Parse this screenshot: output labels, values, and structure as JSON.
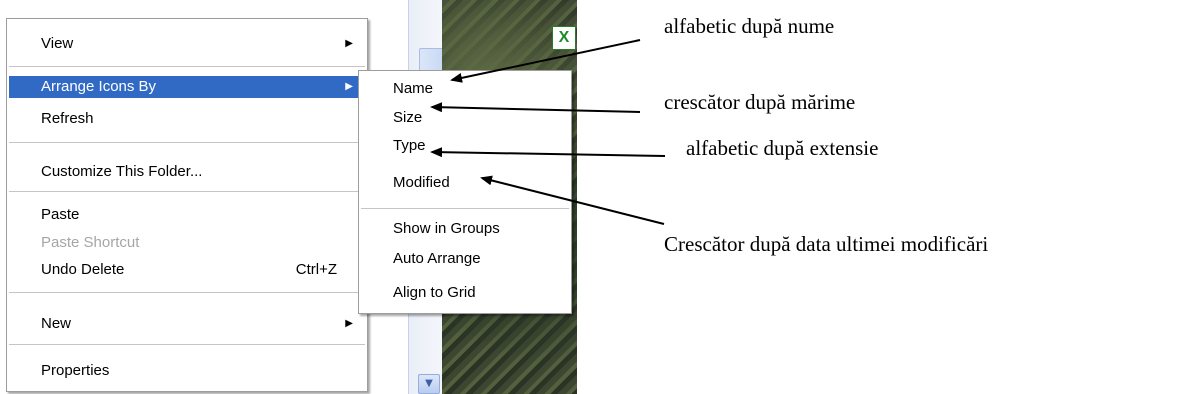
{
  "main_menu": {
    "items": [
      {
        "label": "View",
        "submenu": true
      },
      {
        "label": "Arrange Icons By",
        "submenu": true,
        "highlighted": true
      },
      {
        "label": "Refresh"
      },
      {
        "label": "Customize This Folder..."
      },
      {
        "label": "Paste"
      },
      {
        "label": "Paste Shortcut",
        "disabled": true
      },
      {
        "label": "Undo Delete",
        "shortcut": "Ctrl+Z"
      },
      {
        "label": "New",
        "submenu": true
      },
      {
        "label": "Properties"
      }
    ]
  },
  "sub_menu": {
    "items": [
      {
        "label": "Name"
      },
      {
        "label": "Size"
      },
      {
        "label": "Type"
      },
      {
        "label": "Modified"
      },
      {
        "label": "Show in Groups"
      },
      {
        "label": "Auto Arrange"
      },
      {
        "label": "Align to Grid"
      }
    ]
  },
  "annotations": {
    "name": "alfabetic după nume",
    "size": "crescător după mărime",
    "type": "alfabetic după extensie",
    "modified": "Crescător după data ultimei modificări"
  },
  "icons": {
    "submenu_arrow": "triangle-right-icon",
    "scroll_down": "chevron-down-icon",
    "excel": "excel-file-icon"
  },
  "colors": {
    "highlight": "#316ac5",
    "disabled_text": "#a6a6a6"
  }
}
